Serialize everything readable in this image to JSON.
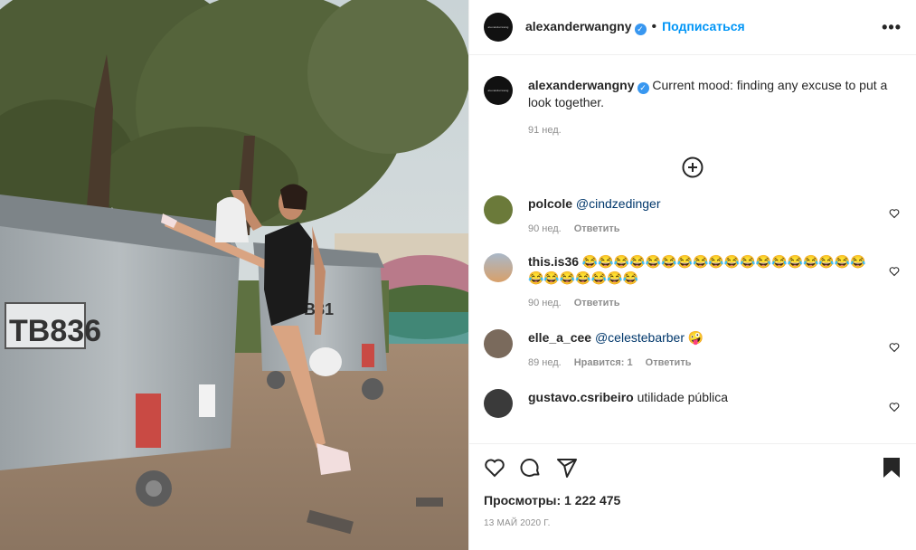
{
  "post": {
    "username": "alexanderwangny",
    "separator": "•",
    "follow_label": "Подписаться",
    "more_label": "•••",
    "avatar_text": "alexanderwang"
  },
  "caption": {
    "username": "alexanderwangny",
    "text": "Current mood: finding any excuse to put a look together.",
    "time": "91 нед."
  },
  "load_more_icon": "plus-circle-icon",
  "comments": [
    {
      "username": "polcole",
      "mention": "@cindzedinger",
      "text": "",
      "time": "90 нед.",
      "reply": "Ответить",
      "likes": ""
    },
    {
      "username": "this.is36",
      "mention": "",
      "text": "😂😂😂😂😂😂😂😂😂😂😂😂😂😂😂😂😂😂😂😂😂😂😂😂😂",
      "time": "90 нед.",
      "reply": "Ответить",
      "likes": ""
    },
    {
      "username": "elle_a_cee",
      "mention": "@celestebarber",
      "text": "🤪",
      "time": "89 нед.",
      "likes": "Нравится: 1",
      "reply": "Ответить"
    },
    {
      "username": "gustavo.csribeiro",
      "mention": "",
      "text": "utilidade pública",
      "time": "",
      "reply": "",
      "likes": ""
    }
  ],
  "footer": {
    "views": "Просмотры: 1 222 475",
    "date": "13 МАЙ 2020 Г.",
    "icons": [
      "heart-icon",
      "comment-icon",
      "share-icon",
      "bookmark-icon"
    ]
  },
  "media": {
    "bin_label_left": "TB836",
    "bin_label_right": "TB81"
  }
}
